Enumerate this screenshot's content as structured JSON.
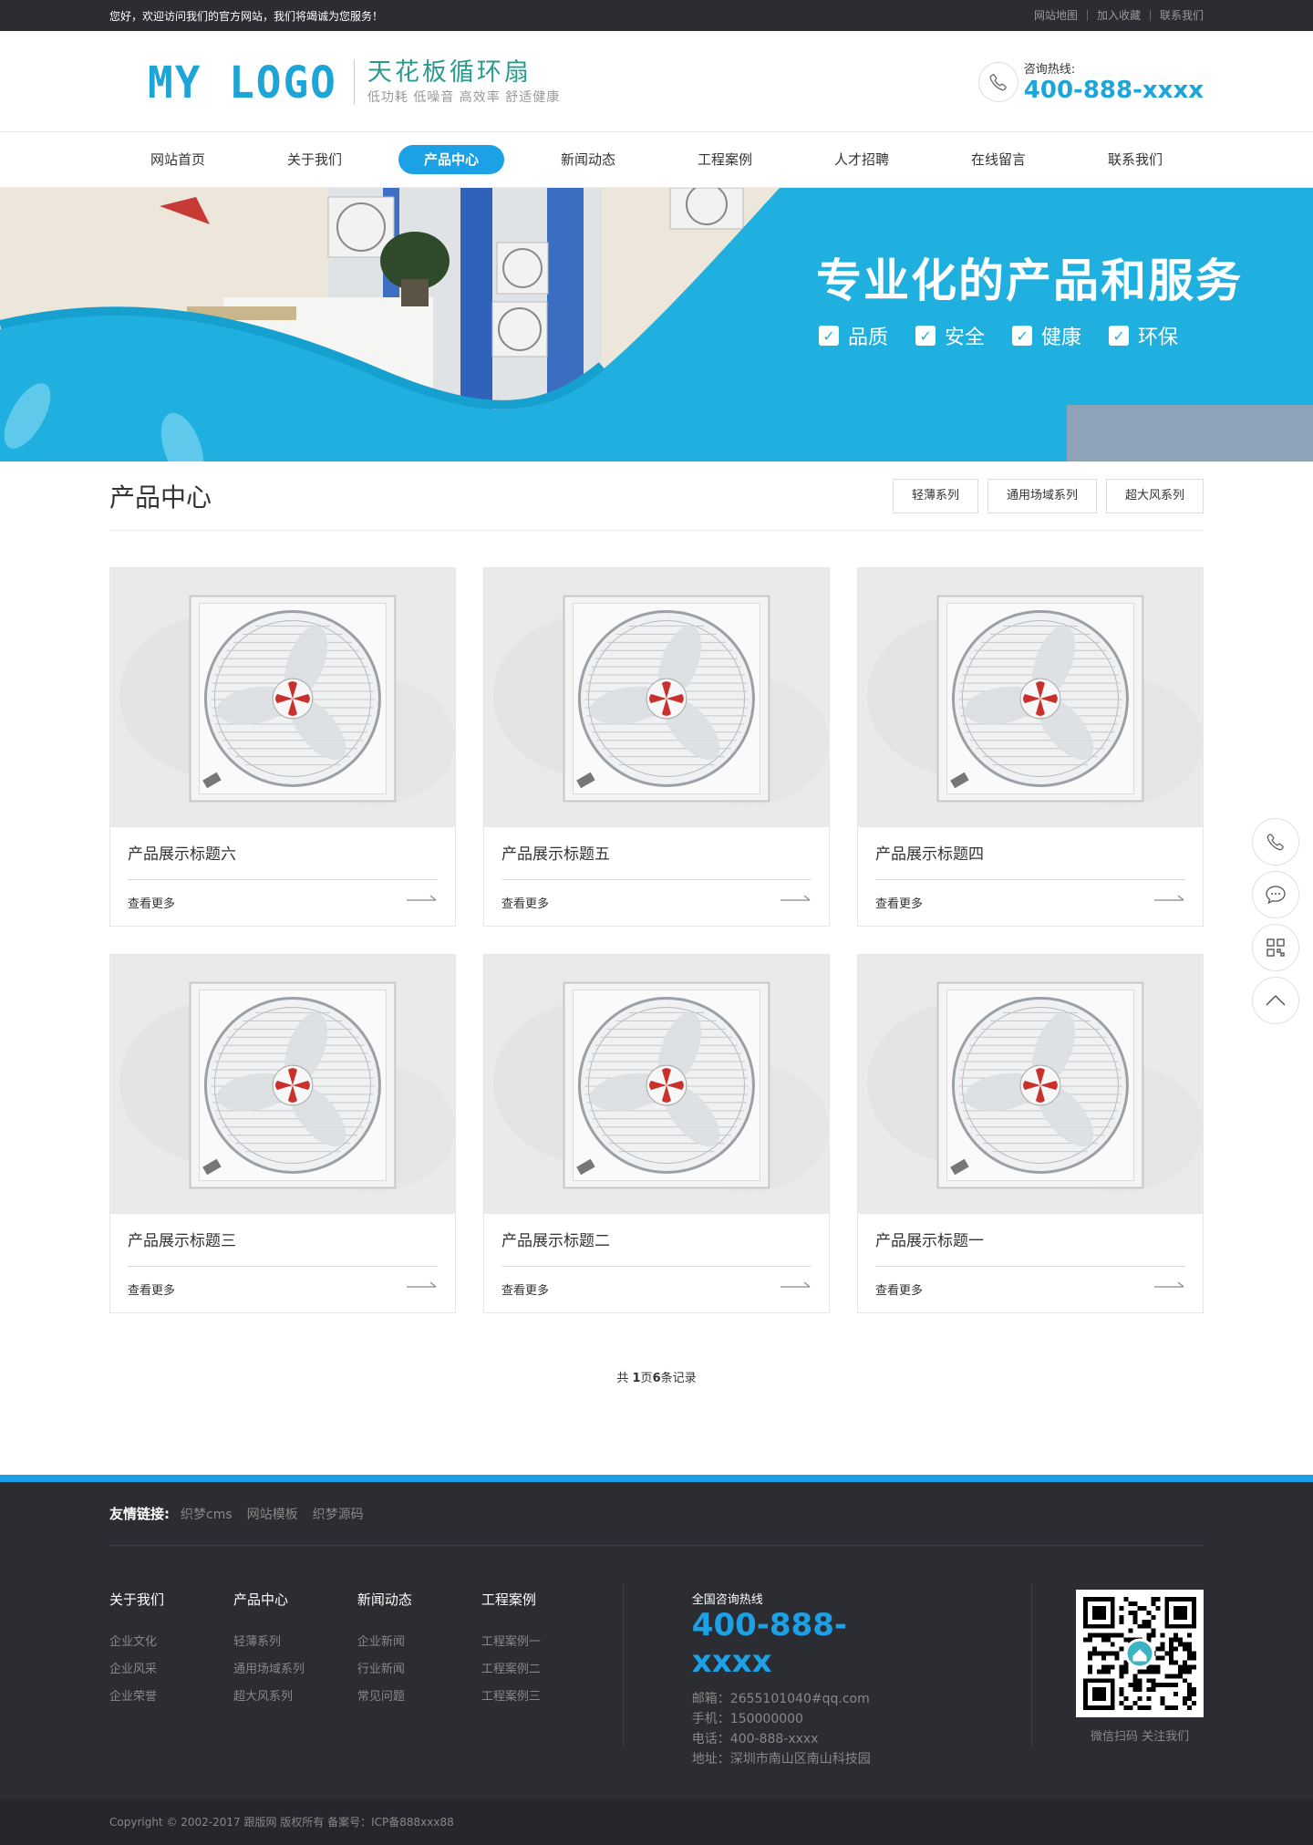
{
  "topbar": {
    "welcome": "您好，欢迎访问我们的官方网站，我们将竭诚为您服务！",
    "links": [
      "网站地图",
      "加入收藏",
      "联系我们"
    ]
  },
  "header": {
    "logo": "MY LOGO",
    "slogan_title": "天花板循环扇",
    "slogan_sub": "低功耗 低噪音 高效率 舒适健康",
    "hotline_label": "咨询热线:",
    "hotline_number": "400-888-xxxx"
  },
  "nav": {
    "items": [
      "网站首页",
      "关于我们",
      "产品中心",
      "新闻动态",
      "工程案例",
      "人才招聘",
      "在线留言",
      "联系我们"
    ],
    "active_index": 2
  },
  "banner": {
    "title": "专业化的产品和服务",
    "tags": [
      "品质",
      "安全",
      "健康",
      "环保"
    ]
  },
  "products": {
    "section_title": "产品中心",
    "categories": [
      "轻薄系列",
      "通用场域系列",
      "超大风系列"
    ],
    "items": [
      {
        "title": "产品展示标题六",
        "more": "查看更多"
      },
      {
        "title": "产品展示标题五",
        "more": "查看更多"
      },
      {
        "title": "产品展示标题四",
        "more": "查看更多"
      },
      {
        "title": "产品展示标题三",
        "more": "查看更多"
      },
      {
        "title": "产品展示标题二",
        "more": "查看更多"
      },
      {
        "title": "产品展示标题一",
        "more": "查看更多"
      }
    ],
    "pager": {
      "pre": "共 ",
      "pages": "1",
      "mid": "页",
      "count": "6",
      "post": "条记录"
    }
  },
  "footer": {
    "links_label": "友情链接:",
    "links": [
      "织梦cms",
      "网站模板",
      "织梦源码"
    ],
    "columns": [
      {
        "title": "关于我们",
        "items": [
          "企业文化",
          "企业风采",
          "企业荣誉"
        ]
      },
      {
        "title": "产品中心",
        "items": [
          "轻薄系列",
          "通用场域系列",
          "超大风系列"
        ]
      },
      {
        "title": "新闻动态",
        "items": [
          "企业新闻",
          "行业新闻",
          "常见问题"
        ]
      },
      {
        "title": "工程案例",
        "items": [
          "工程案例一",
          "工程案例二",
          "工程案例三"
        ]
      }
    ],
    "contact": {
      "label": "全国咨询热线",
      "number": "400-888-xxxx",
      "email": "邮箱：2655101040#qq.com",
      "mobile": "手机：150000000",
      "phone": "电话：400-888-xxxx",
      "address": "地址：深圳市南山区南山科技园"
    },
    "qr_caption": "微信扫码 关注我们",
    "copyright": "Copyright © 2002-2017 跟版网 版权所有    备案号：ICP备888xxx88"
  },
  "colors": {
    "accent": "#1da1e6",
    "dark": "#2b2d33",
    "banner_blue": "#1fb0df"
  },
  "side_icons": [
    "phone-icon",
    "chat-icon",
    "qrcode-icon",
    "chevron-up-icon"
  ]
}
